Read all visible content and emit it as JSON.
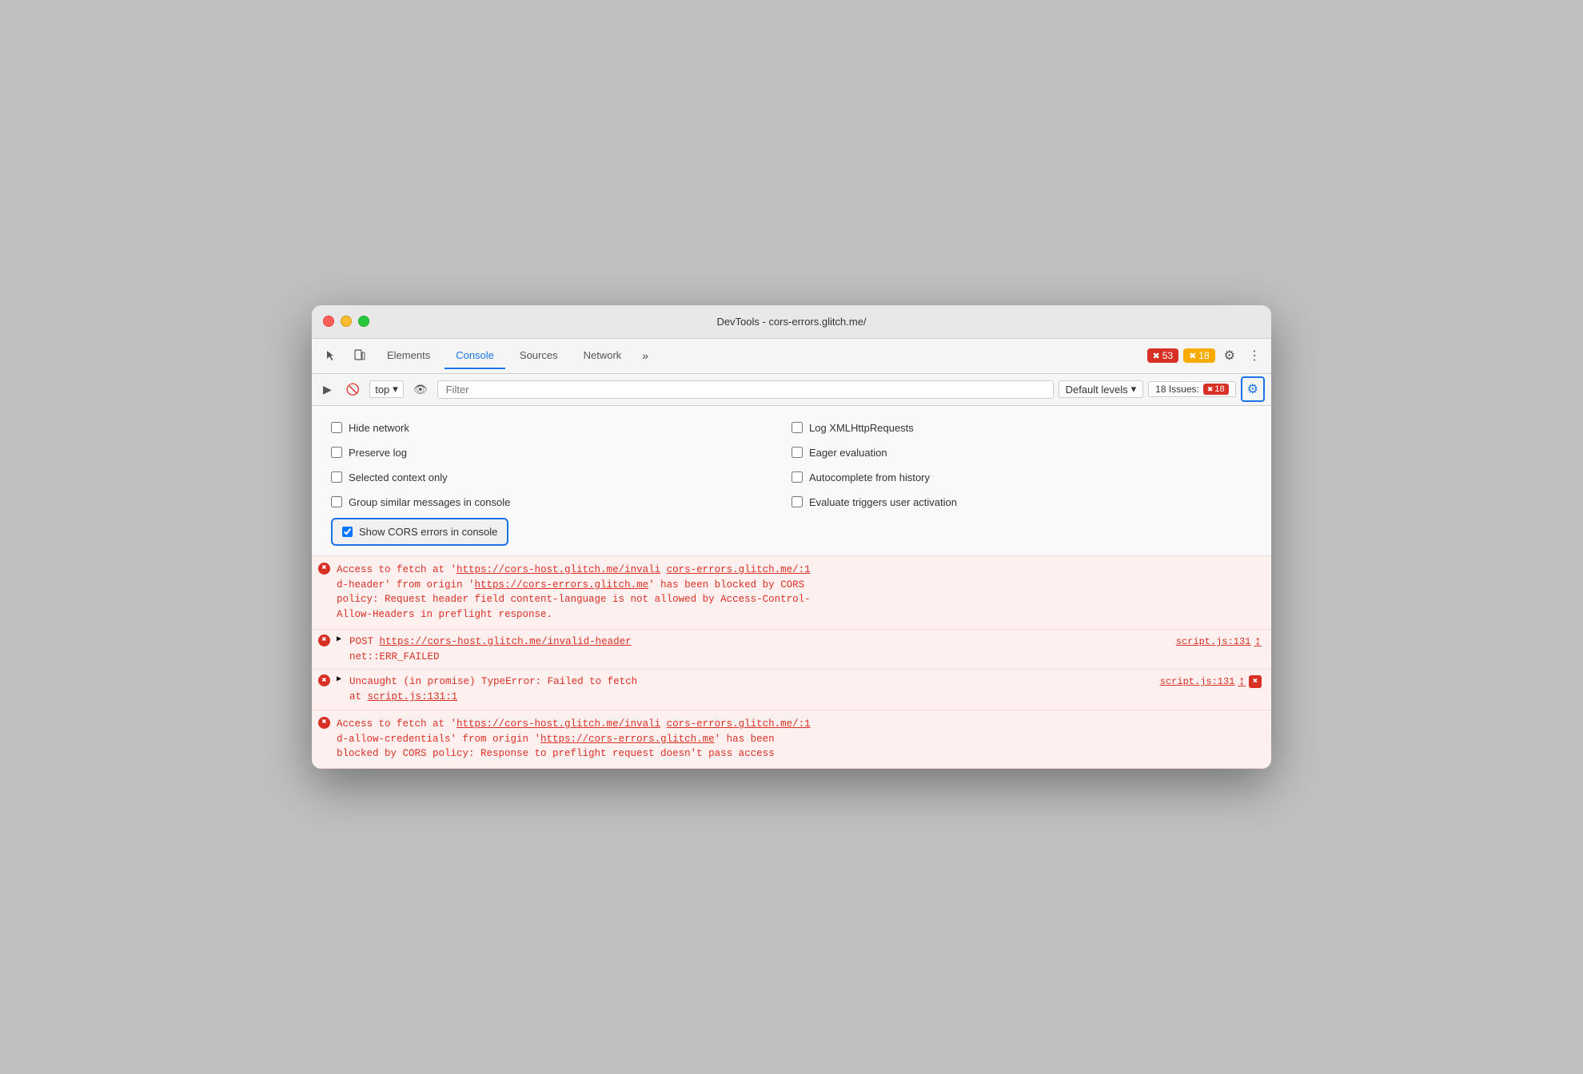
{
  "window": {
    "title": "DevTools - cors-errors.glitch.me/"
  },
  "toolbar": {
    "tabs": [
      {
        "label": "Elements",
        "active": false
      },
      {
        "label": "Console",
        "active": true
      },
      {
        "label": "Sources",
        "active": false
      },
      {
        "label": "Network",
        "active": false
      }
    ],
    "more_label": "»",
    "error_count": "53",
    "warn_count": "18",
    "settings_label": "⚙",
    "more_options_label": "⋮"
  },
  "console_toolbar": {
    "clear_label": "🚫",
    "top_label": "top",
    "eye_label": "👁",
    "filter_placeholder": "Filter",
    "default_levels_label": "Default levels",
    "issues_label": "18 Issues:",
    "issues_count": "18"
  },
  "settings_panel": {
    "checkboxes_left": [
      {
        "label": "Hide network",
        "checked": false
      },
      {
        "label": "Preserve log",
        "checked": false
      },
      {
        "label": "Selected context only",
        "checked": false
      },
      {
        "label": "Group similar messages in console",
        "checked": false
      }
    ],
    "checkboxes_right": [
      {
        "label": "Log XMLHttpRequests",
        "checked": false
      },
      {
        "label": "Eager evaluation",
        "checked": false
      },
      {
        "label": "Autocomplete from history",
        "checked": false
      },
      {
        "label": "Evaluate triggers user activation",
        "checked": false
      }
    ],
    "cors_checkbox": {
      "label": "Show CORS errors in console",
      "checked": true
    }
  },
  "console_entries": [
    {
      "type": "error",
      "text": "Access to fetch at 'https://cors-host.glitch.me/invali cors-errors.glitch.me/:1\nd-header' from origin 'https://cors-errors.glitch.me' has been blocked by CORS\npolicy: Request header field content-language is not allowed by Access-Control-\nAllow-Headers in preflight response.",
      "link1": "https://cors-host.glitch.me/invali",
      "link2": "cors-errors.glitch.me/:1",
      "link3": "https://cors-errors.glitch.me",
      "source": null
    },
    {
      "type": "error-post",
      "text": "POST https://cors-host.glitch.me/invalid-header",
      "subtext": "net::ERR_FAILED",
      "source": "script.js:131",
      "has_scroll": true
    },
    {
      "type": "error-promise",
      "text": "Uncaught (in promise) TypeError: Failed to fetch",
      "subtext": "at script.js:131:1",
      "source": "script.js:131",
      "has_scroll": true,
      "has_x": true
    },
    {
      "type": "error",
      "text": "Access to fetch at 'https://cors-host.glitch.me/invali cors-errors.glitch.me/:1\nd-allow-credentials' from origin 'https://cors-errors.glitch.me' has been\nblocked by CORS policy: Response to preflight request doesn't pass access",
      "link1": "https://cors-host.glitch.me/invali",
      "link2": "cors-errors.glitch.me/:1",
      "link3": "https://cors-errors.glitch.me",
      "source": null
    }
  ]
}
